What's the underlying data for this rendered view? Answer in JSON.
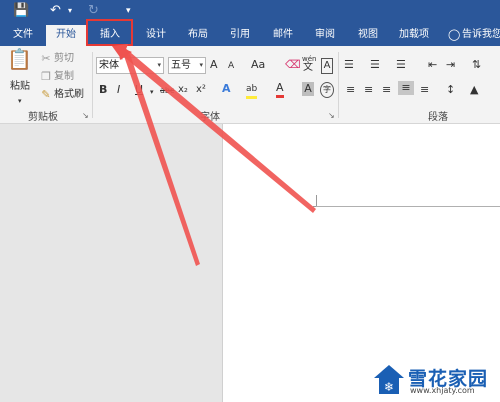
{
  "qat": {
    "icons": [
      "save-icon",
      "undo-icon",
      "redo-icon",
      "customize-icon"
    ]
  },
  "tabs": {
    "file": "文件",
    "home": "开始",
    "insert": "插入",
    "design": "设计",
    "layout": "布局",
    "references": "引用",
    "mailings": "邮件",
    "review": "审阅",
    "view": "视图",
    "addins": "加载项",
    "tellme": "告诉我您想"
  },
  "clipboard": {
    "paste": "粘贴",
    "cut": "剪切",
    "copy": "复制",
    "format_painter": "格式刷",
    "label": "剪贴板"
  },
  "font": {
    "name": "宋体",
    "size": "五号",
    "label": "字体",
    "wen": "wén",
    "wen_char": "文",
    "a_large": "A",
    "a_small": "A",
    "aa": "Aa",
    "bold": "B",
    "italic": "I",
    "underline": "U",
    "strike": "abc",
    "sub": "x₂",
    "sup": "x²",
    "effects": "A",
    "highlight": "ab",
    "color": "A",
    "shade": "A",
    "circle": "字"
  },
  "paragraph": {
    "label": "段落"
  },
  "watermark": {
    "brand": "雪花家园",
    "url": "www.xhjaty.com"
  },
  "colors": {
    "ribbon_blue": "#2b579a",
    "highlight_red": "#e53935",
    "arrow_red": "#ef5350"
  }
}
